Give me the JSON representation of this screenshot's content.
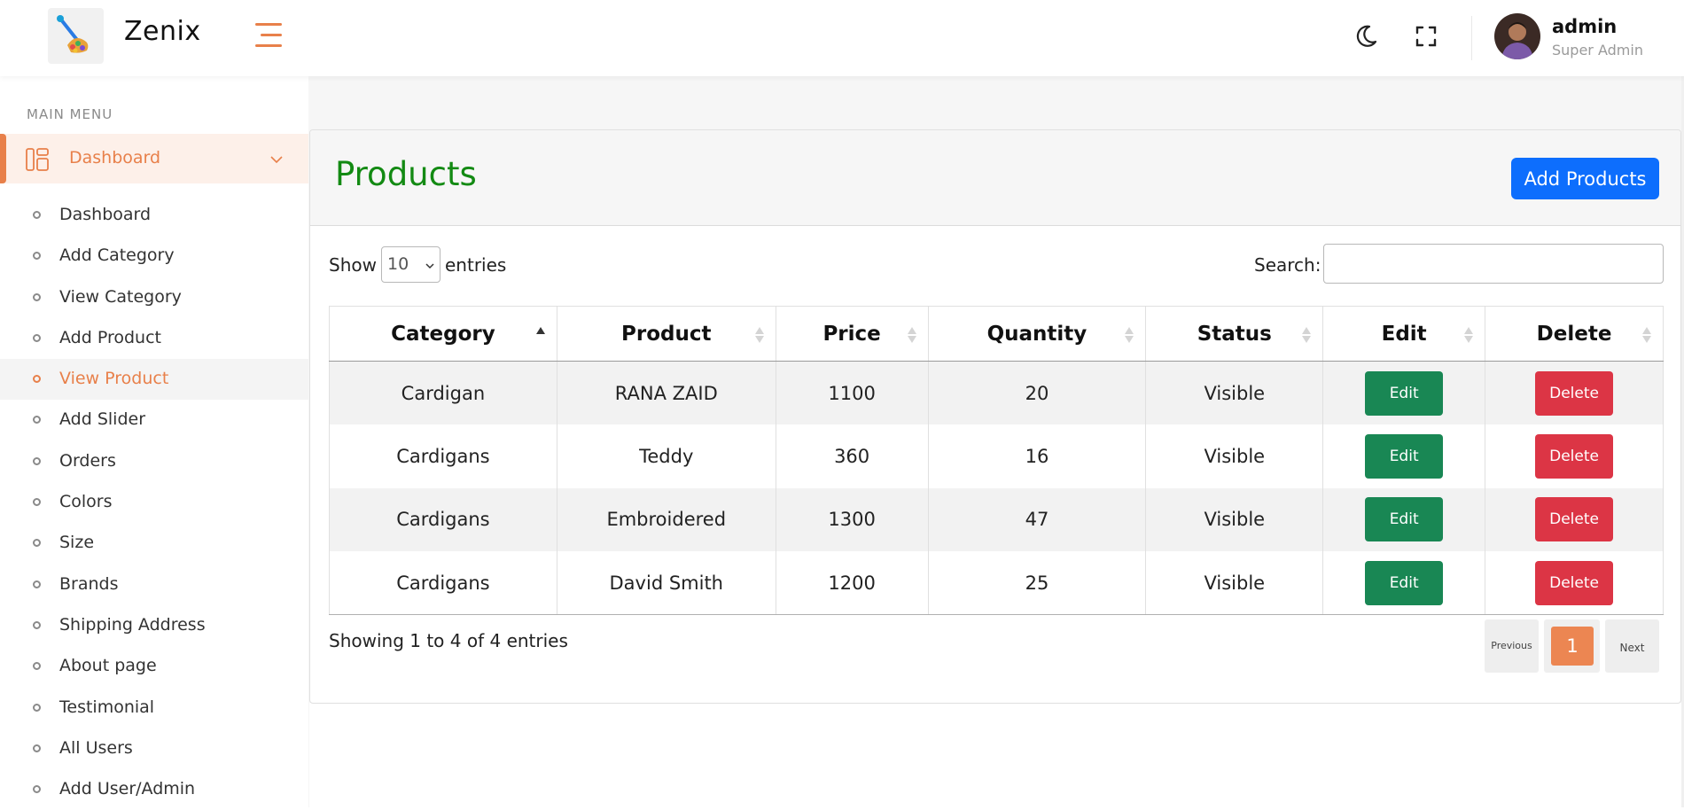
{
  "header": {
    "brand": "Zenix",
    "user_name": "admin",
    "user_role": "Super Admin"
  },
  "icons": {
    "menu_toggle": "hamburger-icon",
    "theme": "moon-icon",
    "fullscreen": "fullscreen-icon",
    "dashboard": "dashboard-icon",
    "expand": "chevron-down-icon",
    "sort": "sort-icon"
  },
  "colors": {
    "accent": "#e8804a",
    "title_green": "#138a13",
    "primary_blue": "#0d6efd",
    "edit_green": "#198754",
    "delete_red": "#dc3545"
  },
  "sidebar": {
    "heading": "MAIN MENU",
    "dashboard_label": "Dashboard",
    "items": [
      {
        "label": "Dashboard"
      },
      {
        "label": "Add Category"
      },
      {
        "label": "View Category"
      },
      {
        "label": "Add Product"
      },
      {
        "label": "View Product"
      },
      {
        "label": "Add Slider"
      },
      {
        "label": "Orders"
      },
      {
        "label": "Colors"
      },
      {
        "label": "Size"
      },
      {
        "label": "Brands"
      },
      {
        "label": "Shipping Address"
      },
      {
        "label": "About page"
      },
      {
        "label": "Testimonial"
      },
      {
        "label": "All Users"
      },
      {
        "label": "Add User/Admin"
      }
    ],
    "active_item": "View Product"
  },
  "page": {
    "title": "Products",
    "add_button": "Add Products",
    "show_label": "Show",
    "entries_value": "10",
    "entries_label": "entries",
    "search_label": "Search:",
    "search_value": "",
    "info": "Showing 1 to 4 of 4 entries",
    "pagination": {
      "previous": "Previous",
      "current": "1",
      "next": "Next"
    }
  },
  "table": {
    "columns": [
      "Category",
      "Product",
      "Price",
      "Quantity",
      "Status",
      "Edit",
      "Delete"
    ],
    "sorted_column": "Category",
    "rows": [
      {
        "category": "Cardigan",
        "product": "RANA ZAID",
        "price": "1100",
        "quantity": "20",
        "status": "Visible",
        "edit": "Edit",
        "delete": "Delete"
      },
      {
        "category": "Cardigans",
        "product": "Teddy",
        "price": "360",
        "quantity": "16",
        "status": "Visible",
        "edit": "Edit",
        "delete": "Delete"
      },
      {
        "category": "Cardigans",
        "product": "Embroidered",
        "price": "1300",
        "quantity": "47",
        "status": "Visible",
        "edit": "Edit",
        "delete": "Delete"
      },
      {
        "category": "Cardigans",
        "product": "David Smith",
        "price": "1200",
        "quantity": "25",
        "status": "Visible",
        "edit": "Edit",
        "delete": "Delete"
      }
    ]
  }
}
